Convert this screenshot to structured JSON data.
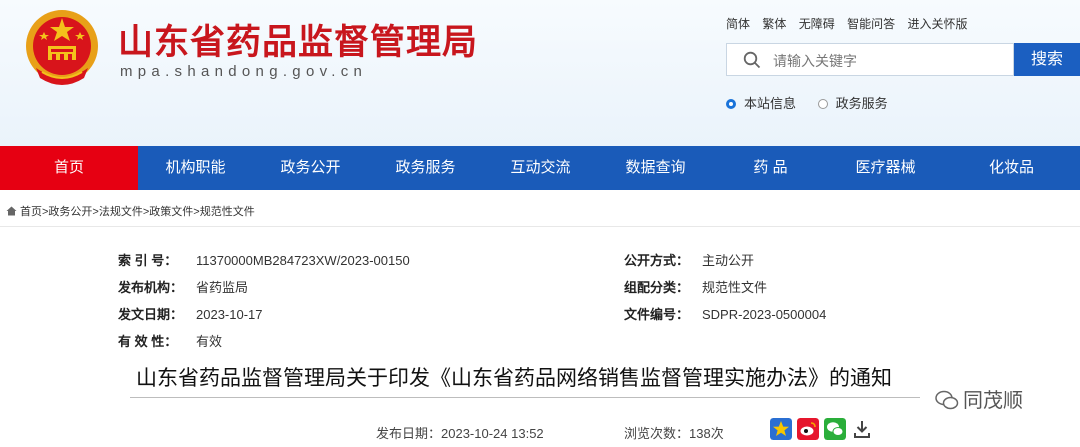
{
  "header": {
    "site_title": "山东省药品监督管理局",
    "site_domain": "mpa.shandong.gov.cn",
    "top_links": [
      "简体",
      "繁体",
      "无障碍",
      "智能问答",
      "进入关怀版"
    ],
    "search": {
      "placeholder": "请输入关键字",
      "button": "搜索"
    },
    "scope_options": [
      {
        "label": "本站信息",
        "selected": true
      },
      {
        "label": "政务服务",
        "selected": false
      }
    ]
  },
  "nav": {
    "items": [
      "首页",
      "机构职能",
      "政务公开",
      "政务服务",
      "互动交流",
      "数据查询",
      "药 品",
      "医疗器械",
      "化妆品"
    ],
    "active_index": 0
  },
  "breadcrumb": "首页>政务公开>法规文件>政策文件>规范性文件",
  "doc_meta": {
    "left": [
      {
        "key": "索 引 号：",
        "value": "11370000MB284723XW/2023-00150"
      },
      {
        "key": "发布机构：",
        "value": "省药监局"
      },
      {
        "key": "发文日期：",
        "value": "2023-10-17"
      },
      {
        "key": "有 效 性：",
        "value": "有效"
      }
    ],
    "right": [
      {
        "key": "公开方式：",
        "value": "主动公开"
      },
      {
        "key": "组配分类：",
        "value": "规范性文件"
      },
      {
        "key": "文件编号：",
        "value": "SDPR-2023-0500004"
      }
    ]
  },
  "document": {
    "title": "山东省药品监督管理局关于印发《山东省药品网络销售监督管理实施办法》的通知",
    "publish_label": "发布日期：",
    "publish_date": "2023-10-24 13:52",
    "views_label": "浏览次数：",
    "views": "138次"
  },
  "share_icons": [
    "favorite-star-icon",
    "weibo-icon",
    "wechat-icon",
    "download-icon"
  ],
  "watermark": "同茂顺",
  "colors": {
    "brand_red": "#c8161d",
    "nav_blue": "#1a5bb9",
    "nav_active": "#e60012",
    "search_blue": "#1b5fc1"
  }
}
